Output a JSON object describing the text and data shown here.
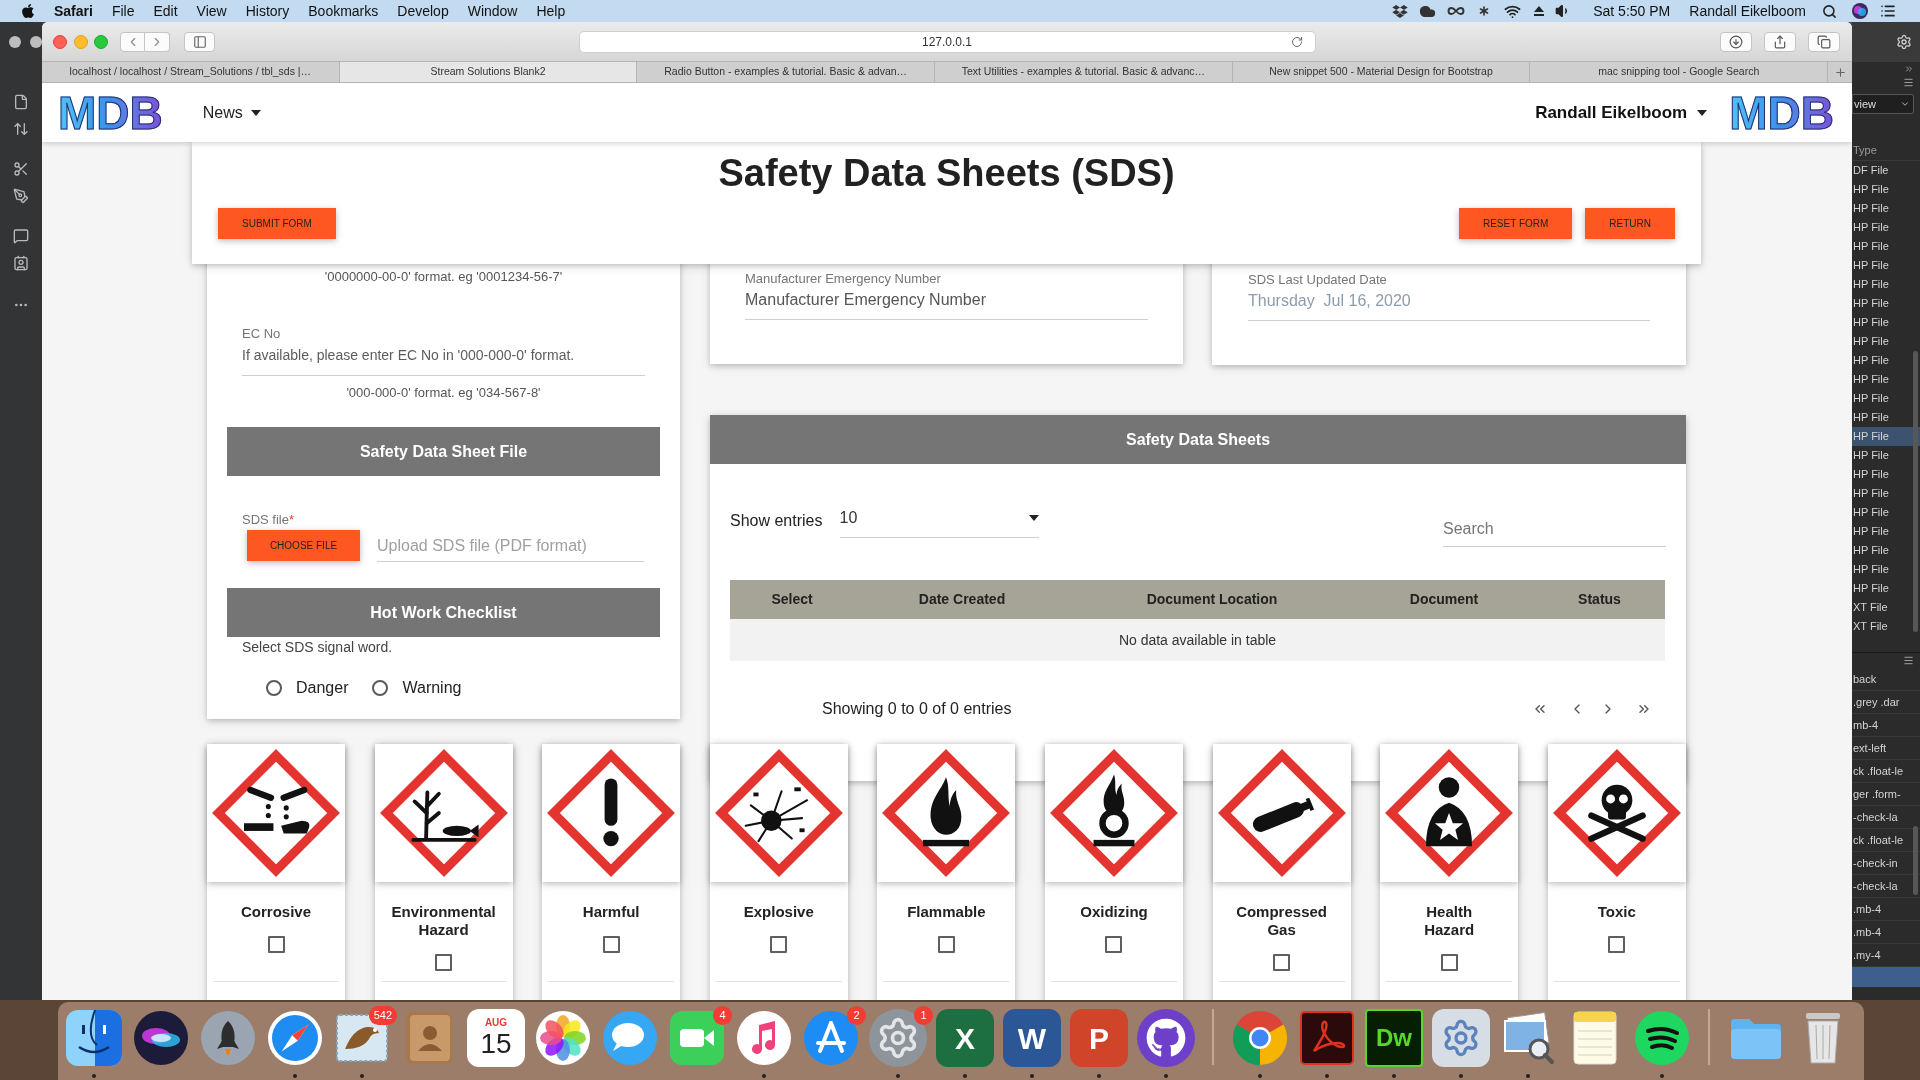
{
  "menu_bar": {
    "app": "Safari",
    "menus": [
      "File",
      "Edit",
      "View",
      "History",
      "Bookmarks",
      "Develop",
      "Window",
      "Help"
    ],
    "clock": "Sat 5:50 PM",
    "user": "Randall Eikelboom"
  },
  "browser": {
    "address": "127.0.0.1",
    "tabs": [
      {
        "title": "localhost / localhost / Stream_Solutions / tbl_sds |…",
        "selected": false
      },
      {
        "title": "Stream Solutions Blank2",
        "selected": true
      },
      {
        "title": "Radio Button - examples & tutorial. Basic & advan…",
        "selected": false
      },
      {
        "title": "Text Utilities - examples & tutorial. Basic & advanc…",
        "selected": false
      },
      {
        "title": "New snippet 500 - Material Design for Bootstrap",
        "selected": false
      },
      {
        "title": "mac snipping tool - Google Search",
        "selected": false
      }
    ]
  },
  "navbar": {
    "logo": "MDB",
    "menu": "News",
    "user": "Randall Eikelboom",
    "logo_right": "MDB"
  },
  "header": {
    "title": "Safety Data Sheets (SDS)",
    "left_buttons": [
      "SUBMIT FORM"
    ],
    "right_buttons": [
      "RESET FORM",
      "RETURN"
    ]
  },
  "form": {
    "cas_hint": "'0000000-00-0' format. eg '0001234-56-7'",
    "ec_no": {
      "label": "EC No",
      "placeholder": "If available, please enter EC No in '000-000-0' format.",
      "hint": "'000-000-0' format. eg '034-567-8'"
    },
    "file_section": "Safety Data Sheet File",
    "sds_file": {
      "label": "SDS file",
      "required_mark": "*",
      "button": "CHOOSE FILE",
      "placeholder": "Upload SDS file (PDF format)"
    },
    "checklist_section": "Hot Work Checklist",
    "signal_prompt": "Select SDS signal word.",
    "signal_words": [
      {
        "label": "Danger",
        "selected": false
      },
      {
        "label": "Warning",
        "selected": false
      }
    ]
  },
  "emergency_number": {
    "label": "Manufacturer Emergency Number",
    "placeholder": "Manufacturer Emergency Number"
  },
  "updated_date": {
    "label": "SDS Last Updated Date",
    "value": "Thursday  Jul 16, 2020"
  },
  "sds_table": {
    "title": "Safety Data Sheets",
    "length_label": "Show entries",
    "length_value": "10",
    "search_placeholder": "Search",
    "columns": [
      "Select",
      "Date Created",
      "Document Location",
      "Document",
      "Status"
    ],
    "empty_message": "No data available in table",
    "info": "Showing 0 to 0 of 0 entries"
  },
  "hazards": [
    {
      "kind": "corrosive",
      "label": "Corrosive",
      "checked": false
    },
    {
      "kind": "environmental",
      "label": "Environmental Hazard",
      "checked": false
    },
    {
      "kind": "harmful",
      "label": "Harmful",
      "checked": false
    },
    {
      "kind": "explosive",
      "label": "Explosive",
      "checked": false
    },
    {
      "kind": "flammable",
      "label": "Flammable",
      "checked": false
    },
    {
      "kind": "oxidizing",
      "label": "Oxidizing",
      "checked": false
    },
    {
      "kind": "compressed_gas",
      "label": "Compressed Gas",
      "checked": false
    },
    {
      "kind": "health",
      "label": "Health Hazard",
      "checked": false
    },
    {
      "kind": "toxic",
      "label": "Toxic",
      "checked": false
    }
  ],
  "background_app": {
    "view": "view",
    "files_header": "Type",
    "files": [
      {
        "type": "DF File",
        "selected": false
      },
      {
        "type": "HP File",
        "selected": false
      },
      {
        "type": "HP File",
        "selected": false
      },
      {
        "type": "HP File",
        "selected": false
      },
      {
        "type": "HP File",
        "selected": false
      },
      {
        "type": "HP File",
        "selected": false
      },
      {
        "type": "HP File",
        "selected": false
      },
      {
        "type": "HP File",
        "selected": false
      },
      {
        "type": "HP File",
        "selected": false
      },
      {
        "type": "HP File",
        "selected": false
      },
      {
        "type": "HP File",
        "selected": false
      },
      {
        "type": "HP File",
        "selected": false
      },
      {
        "type": "HP File",
        "selected": false
      },
      {
        "type": "HP File",
        "selected": false
      },
      {
        "type": "HP File",
        "selected": true
      },
      {
        "type": "HP File",
        "selected": false
      },
      {
        "type": "HP File",
        "selected": false
      },
      {
        "type": "HP File",
        "selected": false
      },
      {
        "type": "HP File",
        "selected": false
      },
      {
        "type": "HP File",
        "selected": false
      },
      {
        "type": "HP File",
        "selected": false
      },
      {
        "type": "HP File",
        "selected": false
      },
      {
        "type": "HP File",
        "selected": false
      },
      {
        "type": "XT File",
        "selected": false
      },
      {
        "type": "XT File",
        "selected": false
      }
    ],
    "rules": [
      "back",
      ".grey .dar",
      "mb-4",
      "ext-left",
      "ck .float-le",
      "ger .form-",
      "-check-la",
      "ck .float-le",
      "-check-in",
      "-check-la",
      ".mb-4",
      ".mb-4",
      ".my-4"
    ]
  },
  "dock": [
    {
      "kind": "finder",
      "running": true
    },
    {
      "kind": "siri",
      "running": false
    },
    {
      "kind": "launchpad",
      "running": false
    },
    {
      "kind": "safari",
      "running": true
    },
    {
      "kind": "mail",
      "badge": "542",
      "running": true
    },
    {
      "kind": "contacts",
      "running": false
    },
    {
      "kind": "calendar",
      "month": "AUG",
      "day": "15",
      "running": false
    },
    {
      "kind": "photos",
      "running": false
    },
    {
      "kind": "messages",
      "running": false
    },
    {
      "kind": "facetime",
      "badge": "4",
      "running": false
    },
    {
      "kind": "music",
      "running": true
    },
    {
      "kind": "appstore",
      "badge": "2",
      "running": false
    },
    {
      "kind": "settings",
      "badge": "1",
      "running": true
    },
    {
      "kind": "excel",
      "letter": "X",
      "running": true
    },
    {
      "kind": "word",
      "letter": "W",
      "running": true
    },
    {
      "kind": "powerpoint",
      "letter": "P",
      "running": true
    },
    {
      "kind": "github",
      "running": true
    },
    {
      "kind": "separator"
    },
    {
      "kind": "chrome",
      "running": true
    },
    {
      "kind": "acrobat",
      "running": true
    },
    {
      "kind": "dreamweaver",
      "letter": "Dw",
      "running": true
    },
    {
      "kind": "utility",
      "running": true
    },
    {
      "kind": "preview",
      "running": true
    },
    {
      "kind": "notes",
      "running": false
    },
    {
      "kind": "spotify",
      "running": true
    },
    {
      "kind": "separator"
    },
    {
      "kind": "folder",
      "running": false
    },
    {
      "kind": "trash",
      "running": false
    }
  ]
}
